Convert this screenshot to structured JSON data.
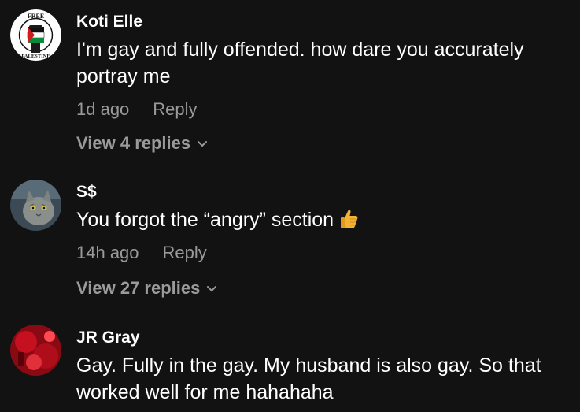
{
  "comments": [
    {
      "username": "Koti Elle",
      "avatar_icon": "free-palestine-fist-icon",
      "avatar_text_top": "FREE",
      "avatar_text_bottom": "PALESTINE",
      "text": "I'm gay and fully offended. how dare you accurately portray me",
      "time": "1d ago",
      "reply_label": "Reply",
      "view_replies": "View 4 replies"
    },
    {
      "username": "S$",
      "avatar_icon": "cat-avatar-icon",
      "text": "You forgot the “angry” section",
      "emoji_icon": "thumbs-up-icon",
      "time": "14h ago",
      "reply_label": "Reply",
      "view_replies": "View 27 replies"
    },
    {
      "username": "JR Gray",
      "avatar_icon": "red-photo-avatar-icon",
      "text": "Gay. Fully in the gay. My husband is also gay. So that worked well for me hahahaha"
    }
  ],
  "colors": {
    "background": "#121212",
    "primary_text": "#ffffff",
    "secondary_text": "#9a9a9a"
  }
}
